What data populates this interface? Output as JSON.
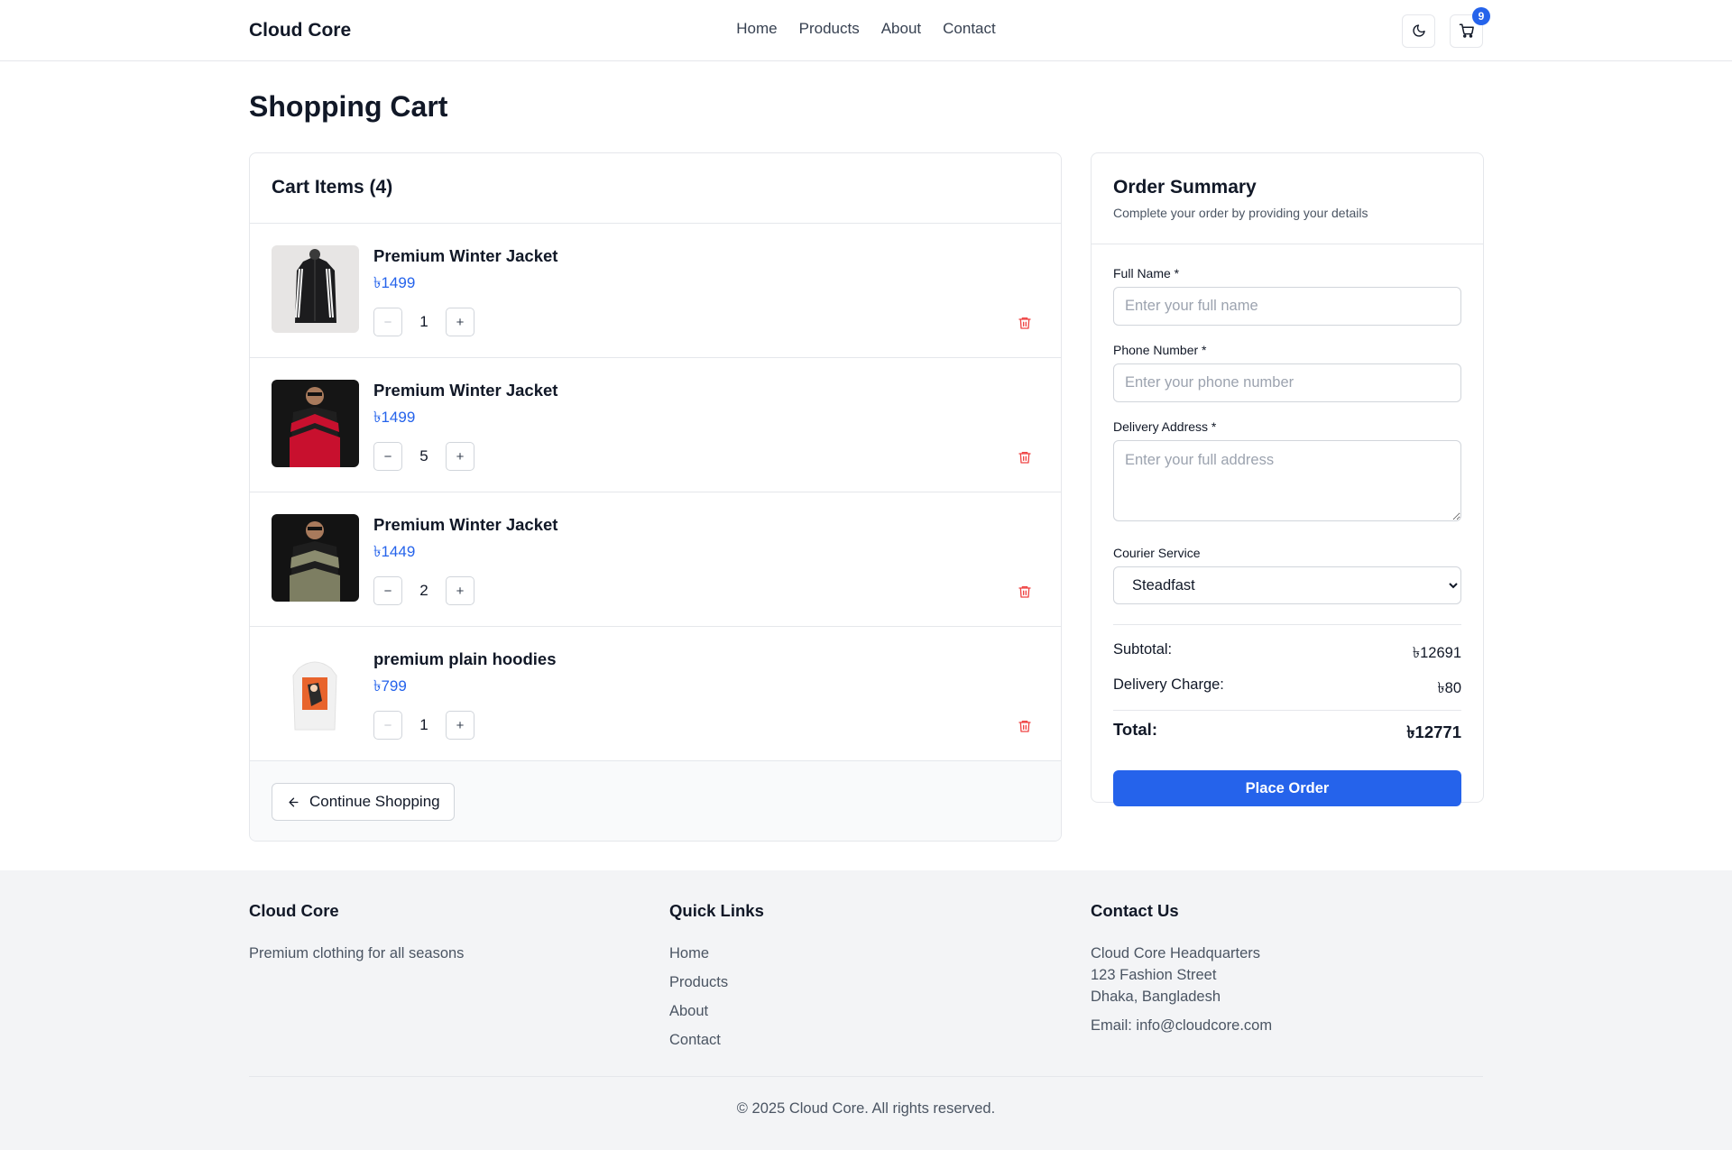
{
  "header": {
    "brand": "Cloud Core",
    "nav": [
      "Home",
      "Products",
      "About",
      "Contact"
    ],
    "cart_count": "9"
  },
  "page": {
    "title": "Shopping Cart"
  },
  "cart": {
    "heading": "Cart Items (4)",
    "items": [
      {
        "name": "Premium Winter Jacket",
        "price": "৳1499",
        "qty": "1",
        "thumb": "black-jacket-white-stripes"
      },
      {
        "name": "Premium Winter Jacket",
        "price": "৳1499",
        "qty": "5",
        "thumb": "black-red-jacket"
      },
      {
        "name": "Premium Winter Jacket",
        "price": "৳1449",
        "qty": "2",
        "thumb": "black-olive-jacket"
      },
      {
        "name": "premium plain hoodies",
        "price": "৳799",
        "qty": "1",
        "thumb": "white-printed-hoodie"
      }
    ],
    "continue_label": "Continue Shopping"
  },
  "summary": {
    "title": "Order Summary",
    "subtitle": "Complete your order by providing your details",
    "full_name_label": "Full Name *",
    "full_name_placeholder": "Enter your full name",
    "phone_label": "Phone Number *",
    "phone_placeholder": "Enter your phone number",
    "address_label": "Delivery Address *",
    "address_placeholder": "Enter your full address",
    "courier_label": "Courier Service",
    "courier_value": "Steadfast",
    "subtotal_label": "Subtotal:",
    "subtotal_value": "৳12691",
    "delivery_label": "Delivery Charge:",
    "delivery_value": "৳80",
    "total_label": "Total:",
    "total_value": "৳12771",
    "place_order_label": "Place Order"
  },
  "footer": {
    "brand_title": "Cloud Core",
    "tagline": "Premium clothing for all seasons",
    "links_title": "Quick Links",
    "links": [
      "Home",
      "Products",
      "About",
      "Contact"
    ],
    "contact_title": "Contact Us",
    "address_line1": "Cloud Core Headquarters",
    "address_line2": "123 Fashion Street",
    "address_line3": "Dhaka, Bangladesh",
    "email": "Email: info@cloudcore.com",
    "copyright": "© 2025 Cloud Core. All rights reserved."
  },
  "colors": {
    "accent": "#2563eb",
    "danger": "#ef4444",
    "footer_bg": "#f3f4f6",
    "border": "#e5e7eb"
  },
  "icons": {
    "theme": "moon-icon",
    "cart": "cart-icon",
    "delete": "trash-icon",
    "back": "arrow-left-icon"
  }
}
